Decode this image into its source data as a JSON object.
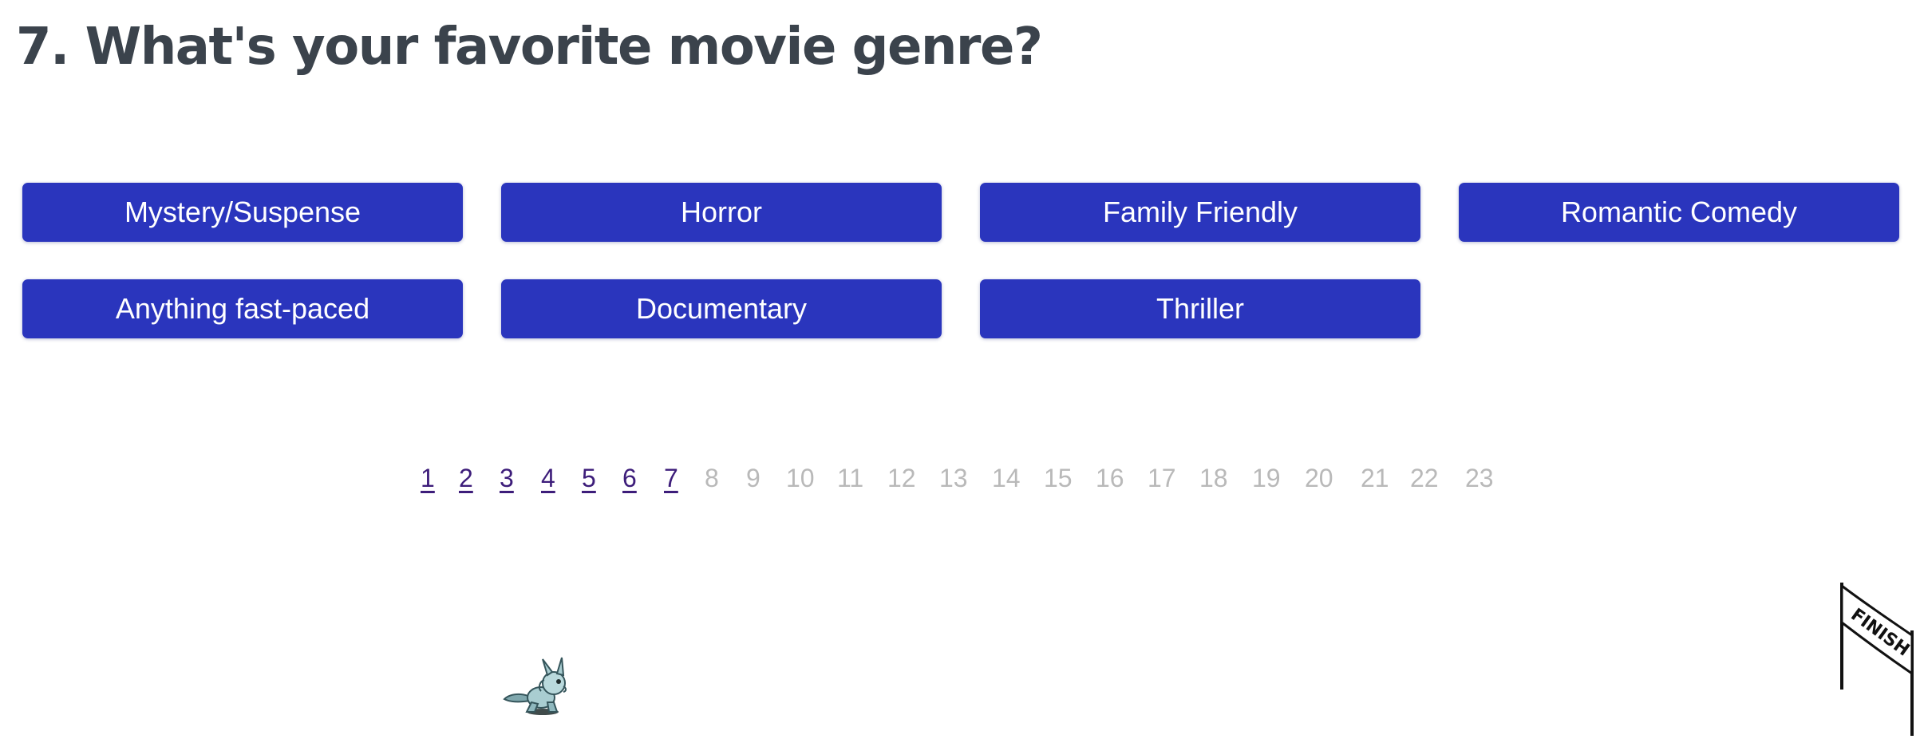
{
  "question": {
    "number": "7.",
    "text": "What's your favorite movie genre?",
    "full": "7. What's your favorite movie genre?"
  },
  "choices": [
    "Mystery/Suspense",
    "Horror",
    "Family Friendly",
    "Romantic Comedy",
    "Anything fast-paced",
    "Documentary",
    "Thriller"
  ],
  "pagination": {
    "current": 7,
    "total": 23,
    "pages": [
      "1",
      "2",
      "3",
      "4",
      "5",
      "6",
      "7",
      "8",
      "9",
      "10",
      "11",
      "12",
      "13",
      "14",
      "15",
      "16",
      "17",
      "18",
      "19",
      "20",
      "21",
      "22",
      "23"
    ]
  },
  "progress": {
    "fraction_complete": 0.304,
    "finish_label": "FINISH"
  },
  "colors": {
    "button_bg": "#2a35bd",
    "button_text": "#ffffff",
    "title_text": "#3b434c",
    "visited_link": "#3d1d7a",
    "future_page": "#b9b9b9"
  },
  "icons": {
    "runner": "running-creature-icon",
    "finish": "finish-flag-icon"
  }
}
